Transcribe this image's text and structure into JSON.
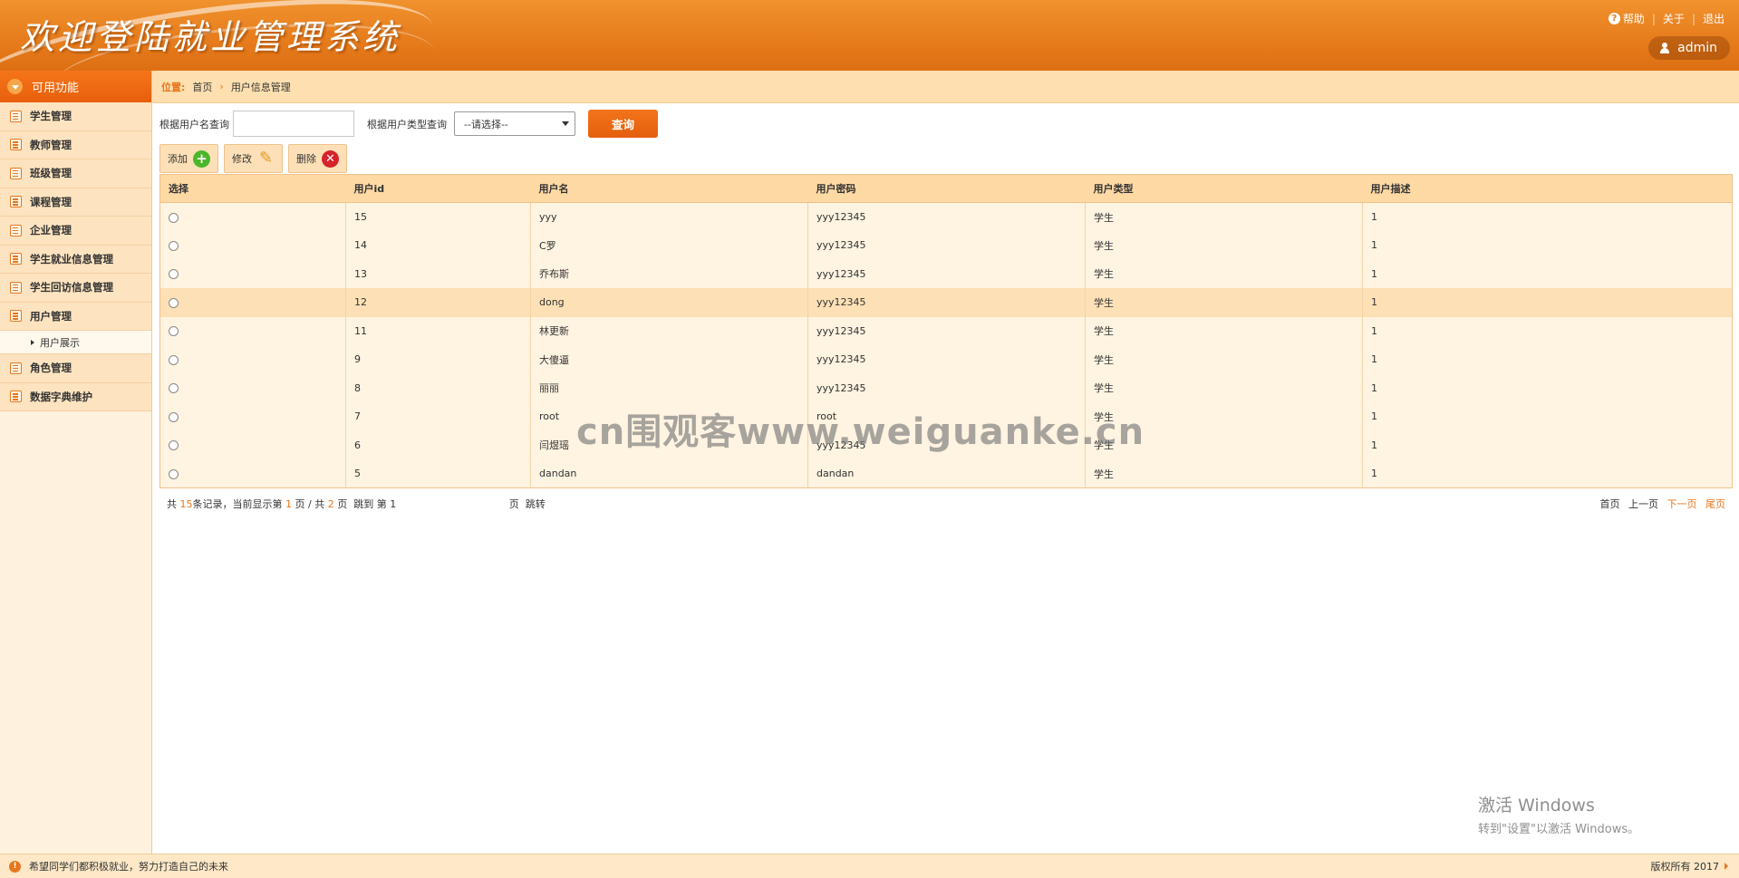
{
  "header": {
    "title": "欢迎登陆就业管理系统",
    "help": "帮助",
    "about": "关于",
    "logout": "退出",
    "user": "admin"
  },
  "sidebar": {
    "heading": "可用功能",
    "items": [
      {
        "label": "学生管理"
      },
      {
        "label": "教师管理"
      },
      {
        "label": "班级管理"
      },
      {
        "label": "课程管理"
      },
      {
        "label": "企业管理"
      },
      {
        "label": "学生就业信息管理"
      },
      {
        "label": "学生回访信息管理"
      },
      {
        "label": "用户管理"
      },
      {
        "label": "角色管理"
      },
      {
        "label": "数据字典维护"
      }
    ],
    "sub_item": "用户展示"
  },
  "breadcrumb": {
    "label": "位置:",
    "home": "首页",
    "current": "用户信息管理"
  },
  "search": {
    "username_label": "根据用户名查询",
    "username_value": "",
    "type_label": "根据用户类型查询",
    "type_selected": "--请选择--",
    "button": "查询"
  },
  "toolbar": {
    "add": "添加",
    "edit": "修改",
    "delete": "删除"
  },
  "table": {
    "headers": [
      "选择",
      "用户id",
      "用户名",
      "用户密码",
      "用户类型",
      "用户描述"
    ],
    "rows": [
      {
        "id": "15",
        "name": "yyy",
        "password": "yyy12345",
        "type": "学生",
        "desc": "1"
      },
      {
        "id": "14",
        "name": "C罗",
        "password": "yyy12345",
        "type": "学生",
        "desc": "1"
      },
      {
        "id": "13",
        "name": "乔布斯",
        "password": "yyy12345",
        "type": "学生",
        "desc": "1"
      },
      {
        "id": "12",
        "name": "dong",
        "password": "yyy12345",
        "type": "学生",
        "desc": "1"
      },
      {
        "id": "11",
        "name": "林更新",
        "password": "yyy12345",
        "type": "学生",
        "desc": "1"
      },
      {
        "id": "9",
        "name": "大傻逼",
        "password": "yyy12345",
        "type": "学生",
        "desc": "1"
      },
      {
        "id": "8",
        "name": "丽丽",
        "password": "yyy12345",
        "type": "学生",
        "desc": "1"
      },
      {
        "id": "7",
        "name": "root",
        "password": "root",
        "type": "学生",
        "desc": "1"
      },
      {
        "id": "6",
        "name": "闫煜瑶",
        "password": "yyy12345",
        "type": "学生",
        "desc": "1"
      },
      {
        "id": "5",
        "name": "dandan",
        "password": "dandan",
        "type": "学生",
        "desc": "1"
      }
    ]
  },
  "pager": {
    "total_prefix": "共",
    "total": "15",
    "total_suffix": "条记录，当前显示第",
    "current_page": "1",
    "page_sep": "页 / 共",
    "total_pages": "2",
    "page_suffix": "页",
    "jump_label": "跳到 第",
    "jump_value": "1",
    "jump_page": "页",
    "jump_button": "跳转",
    "first": "首页",
    "prev": "上一页",
    "next": "下一页",
    "last": "尾页"
  },
  "watermark": "cn围观客www.weiguanke.cn",
  "windows_activation": {
    "line1": "激活 Windows",
    "line2": "转到\"设置\"以激活 Windows。"
  },
  "footer": {
    "message": "希望同学们都积极就业，努力打造自己的未来",
    "copyright": "版权所有 2017"
  },
  "colors": {
    "accent": "#e8761c",
    "header": "#e77d1d",
    "sidebar_bg": "#fef1dd",
    "row_highlight": "#fde0b5"
  }
}
